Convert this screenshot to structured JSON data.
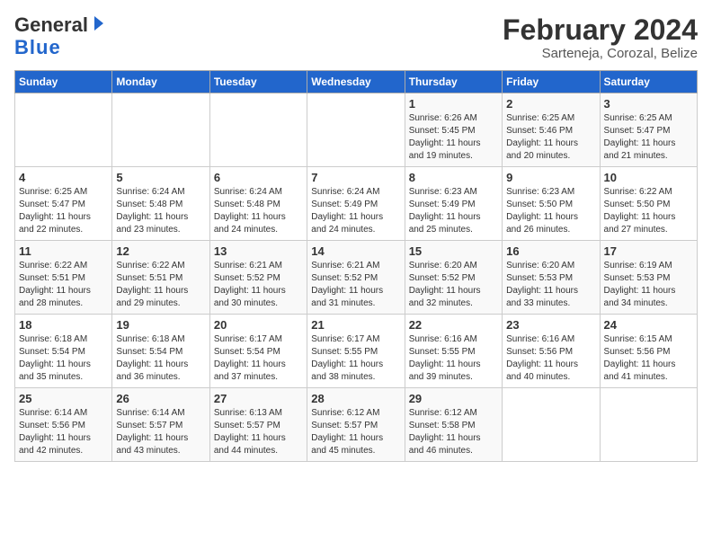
{
  "logo": {
    "line1": "General",
    "line2": "Blue"
  },
  "title": "February 2024",
  "subtitle": "Sarteneja, Corozal, Belize",
  "days_of_week": [
    "Sunday",
    "Monday",
    "Tuesday",
    "Wednesday",
    "Thursday",
    "Friday",
    "Saturday"
  ],
  "weeks": [
    [
      {
        "day": "",
        "info": ""
      },
      {
        "day": "",
        "info": ""
      },
      {
        "day": "",
        "info": ""
      },
      {
        "day": "",
        "info": ""
      },
      {
        "day": "1",
        "info": "Sunrise: 6:26 AM\nSunset: 5:45 PM\nDaylight: 11 hours\nand 19 minutes."
      },
      {
        "day": "2",
        "info": "Sunrise: 6:25 AM\nSunset: 5:46 PM\nDaylight: 11 hours\nand 20 minutes."
      },
      {
        "day": "3",
        "info": "Sunrise: 6:25 AM\nSunset: 5:47 PM\nDaylight: 11 hours\nand 21 minutes."
      }
    ],
    [
      {
        "day": "4",
        "info": "Sunrise: 6:25 AM\nSunset: 5:47 PM\nDaylight: 11 hours\nand 22 minutes."
      },
      {
        "day": "5",
        "info": "Sunrise: 6:24 AM\nSunset: 5:48 PM\nDaylight: 11 hours\nand 23 minutes."
      },
      {
        "day": "6",
        "info": "Sunrise: 6:24 AM\nSunset: 5:48 PM\nDaylight: 11 hours\nand 24 minutes."
      },
      {
        "day": "7",
        "info": "Sunrise: 6:24 AM\nSunset: 5:49 PM\nDaylight: 11 hours\nand 24 minutes."
      },
      {
        "day": "8",
        "info": "Sunrise: 6:23 AM\nSunset: 5:49 PM\nDaylight: 11 hours\nand 25 minutes."
      },
      {
        "day": "9",
        "info": "Sunrise: 6:23 AM\nSunset: 5:50 PM\nDaylight: 11 hours\nand 26 minutes."
      },
      {
        "day": "10",
        "info": "Sunrise: 6:22 AM\nSunset: 5:50 PM\nDaylight: 11 hours\nand 27 minutes."
      }
    ],
    [
      {
        "day": "11",
        "info": "Sunrise: 6:22 AM\nSunset: 5:51 PM\nDaylight: 11 hours\nand 28 minutes."
      },
      {
        "day": "12",
        "info": "Sunrise: 6:22 AM\nSunset: 5:51 PM\nDaylight: 11 hours\nand 29 minutes."
      },
      {
        "day": "13",
        "info": "Sunrise: 6:21 AM\nSunset: 5:52 PM\nDaylight: 11 hours\nand 30 minutes."
      },
      {
        "day": "14",
        "info": "Sunrise: 6:21 AM\nSunset: 5:52 PM\nDaylight: 11 hours\nand 31 minutes."
      },
      {
        "day": "15",
        "info": "Sunrise: 6:20 AM\nSunset: 5:52 PM\nDaylight: 11 hours\nand 32 minutes."
      },
      {
        "day": "16",
        "info": "Sunrise: 6:20 AM\nSunset: 5:53 PM\nDaylight: 11 hours\nand 33 minutes."
      },
      {
        "day": "17",
        "info": "Sunrise: 6:19 AM\nSunset: 5:53 PM\nDaylight: 11 hours\nand 34 minutes."
      }
    ],
    [
      {
        "day": "18",
        "info": "Sunrise: 6:18 AM\nSunset: 5:54 PM\nDaylight: 11 hours\nand 35 minutes."
      },
      {
        "day": "19",
        "info": "Sunrise: 6:18 AM\nSunset: 5:54 PM\nDaylight: 11 hours\nand 36 minutes."
      },
      {
        "day": "20",
        "info": "Sunrise: 6:17 AM\nSunset: 5:54 PM\nDaylight: 11 hours\nand 37 minutes."
      },
      {
        "day": "21",
        "info": "Sunrise: 6:17 AM\nSunset: 5:55 PM\nDaylight: 11 hours\nand 38 minutes."
      },
      {
        "day": "22",
        "info": "Sunrise: 6:16 AM\nSunset: 5:55 PM\nDaylight: 11 hours\nand 39 minutes."
      },
      {
        "day": "23",
        "info": "Sunrise: 6:16 AM\nSunset: 5:56 PM\nDaylight: 11 hours\nand 40 minutes."
      },
      {
        "day": "24",
        "info": "Sunrise: 6:15 AM\nSunset: 5:56 PM\nDaylight: 11 hours\nand 41 minutes."
      }
    ],
    [
      {
        "day": "25",
        "info": "Sunrise: 6:14 AM\nSunset: 5:56 PM\nDaylight: 11 hours\nand 42 minutes."
      },
      {
        "day": "26",
        "info": "Sunrise: 6:14 AM\nSunset: 5:57 PM\nDaylight: 11 hours\nand 43 minutes."
      },
      {
        "day": "27",
        "info": "Sunrise: 6:13 AM\nSunset: 5:57 PM\nDaylight: 11 hours\nand 44 minutes."
      },
      {
        "day": "28",
        "info": "Sunrise: 6:12 AM\nSunset: 5:57 PM\nDaylight: 11 hours\nand 45 minutes."
      },
      {
        "day": "29",
        "info": "Sunrise: 6:12 AM\nSunset: 5:58 PM\nDaylight: 11 hours\nand 46 minutes."
      },
      {
        "day": "",
        "info": ""
      },
      {
        "day": "",
        "info": ""
      }
    ]
  ]
}
